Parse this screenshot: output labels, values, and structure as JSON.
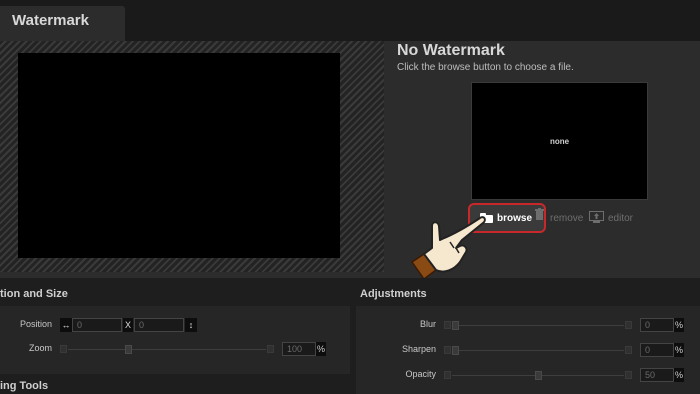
{
  "header": {
    "tab_label": "Watermark"
  },
  "watermark": {
    "title": "No Watermark",
    "hint": "Click the browse button to choose a file.",
    "preview_text": "none",
    "browse_label": "browse",
    "remove_label": "remove",
    "editor_label": "editor"
  },
  "position_size": {
    "heading": "tion and Size",
    "position_label": "Position",
    "pos_x": "0",
    "x_label": "X",
    "pos_y": "0",
    "zoom_label": "Zoom",
    "zoom_value": "100",
    "zoom_unit": "%",
    "zoom_level": 0.3
  },
  "tools": {
    "heading": "ing Tools"
  },
  "adjustments": {
    "heading": "Adjustments",
    "rows": [
      {
        "label": "Blur",
        "value": "0",
        "unit": "%",
        "level": 0.0
      },
      {
        "label": "Sharpen",
        "value": "0",
        "unit": "%",
        "level": 0.0
      },
      {
        "label": "Opacity",
        "value": "50",
        "unit": "%",
        "level": 0.5
      }
    ]
  },
  "colors": {
    "highlight": "#c8282a",
    "panel": "#2c2c2c",
    "background": "#1e1e1e"
  }
}
